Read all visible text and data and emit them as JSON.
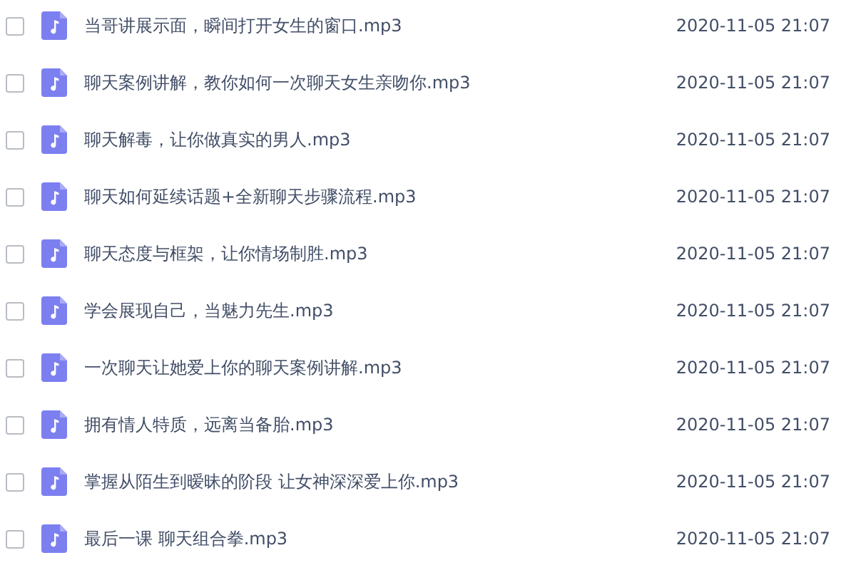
{
  "files": [
    {
      "name": "当哥讲展示面，瞬间打开女生的窗口.mp3",
      "modified": "2020-11-05 21:07",
      "checked": false
    },
    {
      "name": "聊天案例讲解，教你如何一次聊天女生亲吻你.mp3",
      "modified": "2020-11-05 21:07",
      "checked": false
    },
    {
      "name": "聊天解毒，让你做真实的男人.mp3",
      "modified": "2020-11-05 21:07",
      "checked": false
    },
    {
      "name": "聊天如何延续话题+全新聊天步骤流程.mp3",
      "modified": "2020-11-05 21:07",
      "checked": false
    },
    {
      "name": "聊天态度与框架，让你情场制胜.mp3",
      "modified": "2020-11-05 21:07",
      "checked": false
    },
    {
      "name": "学会展现自己，当魅力先生.mp3",
      "modified": "2020-11-05 21:07",
      "checked": false
    },
    {
      "name": "一次聊天让她爱上你的聊天案例讲解.mp3",
      "modified": "2020-11-05 21:07",
      "checked": false
    },
    {
      "name": "拥有情人特质，远离当备胎.mp3",
      "modified": "2020-11-05 21:07",
      "checked": false
    },
    {
      "name": "掌握从陌生到暧昧的阶段 让女神深深爱上你.mp3",
      "modified": "2020-11-05 21:07",
      "checked": false
    },
    {
      "name": "最后一课 聊天组合拳.mp3",
      "modified": "2020-11-05 21:07",
      "checked": false
    }
  ]
}
